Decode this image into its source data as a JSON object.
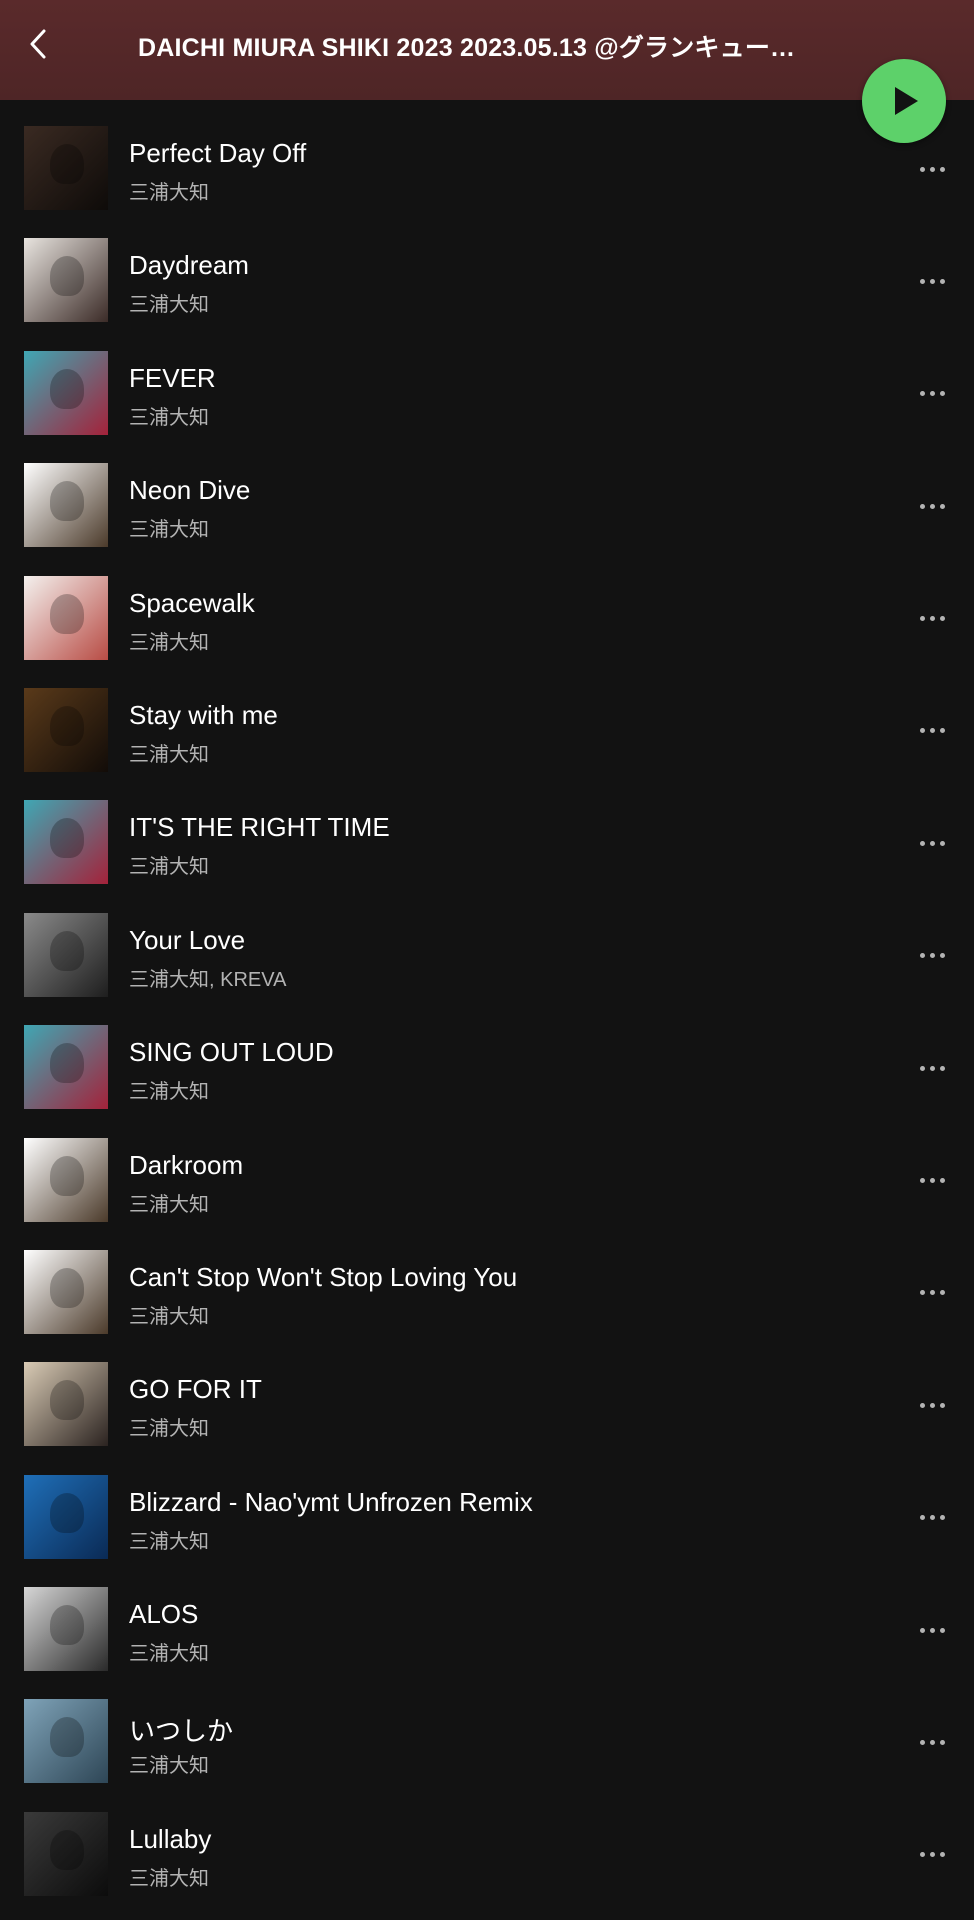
{
  "header": {
    "title": "DAICHI MIURA SHIKI 2023 2023.05.13 @グランキュー…",
    "back_icon": "chevron-left-icon",
    "play_icon": "play-icon",
    "play_color": "#5dd16a",
    "bg_color": "#5a2a2b"
  },
  "tracks": [
    {
      "title": "Perfect Day Off",
      "artist": "三浦大知",
      "cover": [
        "#3a2a22",
        "#0e0b09"
      ]
    },
    {
      "title": "Daydream",
      "artist": "三浦大知",
      "cover": [
        "#e8e4df",
        "#3b2b27"
      ]
    },
    {
      "title": "FEVER",
      "artist": "三浦大知",
      "cover": [
        "#3fa7b4",
        "#a4223a"
      ]
    },
    {
      "title": "Neon Dive",
      "artist": "三浦大知",
      "cover": [
        "#ffffff",
        "#4b3a2a"
      ]
    },
    {
      "title": "Spacewalk",
      "artist": "三浦大知",
      "cover": [
        "#f4f1ee",
        "#b84c45"
      ]
    },
    {
      "title": "Stay with me",
      "artist": "三浦大知",
      "cover": [
        "#5a3a1a",
        "#120c08"
      ]
    },
    {
      "title": "IT'S THE RIGHT TIME",
      "artist": "三浦大知",
      "cover": [
        "#3fa7b4",
        "#a4223a"
      ]
    },
    {
      "title": "Your Love",
      "artist": "三浦大知, KREVA",
      "cover": [
        "#8a8a8a",
        "#1e1e1e"
      ]
    },
    {
      "title": "SING OUT LOUD",
      "artist": "三浦大知",
      "cover": [
        "#3fa7b4",
        "#a4223a"
      ]
    },
    {
      "title": "Darkroom",
      "artist": "三浦大知",
      "cover": [
        "#ffffff",
        "#4b3a2a"
      ]
    },
    {
      "title": "Can't Stop Won't Stop Loving You",
      "artist": "三浦大知",
      "cover": [
        "#ffffff",
        "#4b3a2a"
      ]
    },
    {
      "title": "GO FOR IT",
      "artist": "三浦大知",
      "cover": [
        "#d9cbb5",
        "#2b2320"
      ]
    },
    {
      "title": "Blizzard - Nao'ymt Unfrozen Remix",
      "artist": "三浦大知",
      "cover": [
        "#1f6fb8",
        "#0a2a55"
      ]
    },
    {
      "title": "ALOS",
      "artist": "三浦大知",
      "cover": [
        "#d6d6d6",
        "#2a2a2a"
      ]
    },
    {
      "title": "いつしか",
      "artist": "三浦大知",
      "cover": [
        "#7fa3b8",
        "#2e4656"
      ]
    },
    {
      "title": "Lullaby",
      "artist": "三浦大知",
      "cover": [
        "#3a3a3a",
        "#0c0c0c"
      ]
    }
  ]
}
